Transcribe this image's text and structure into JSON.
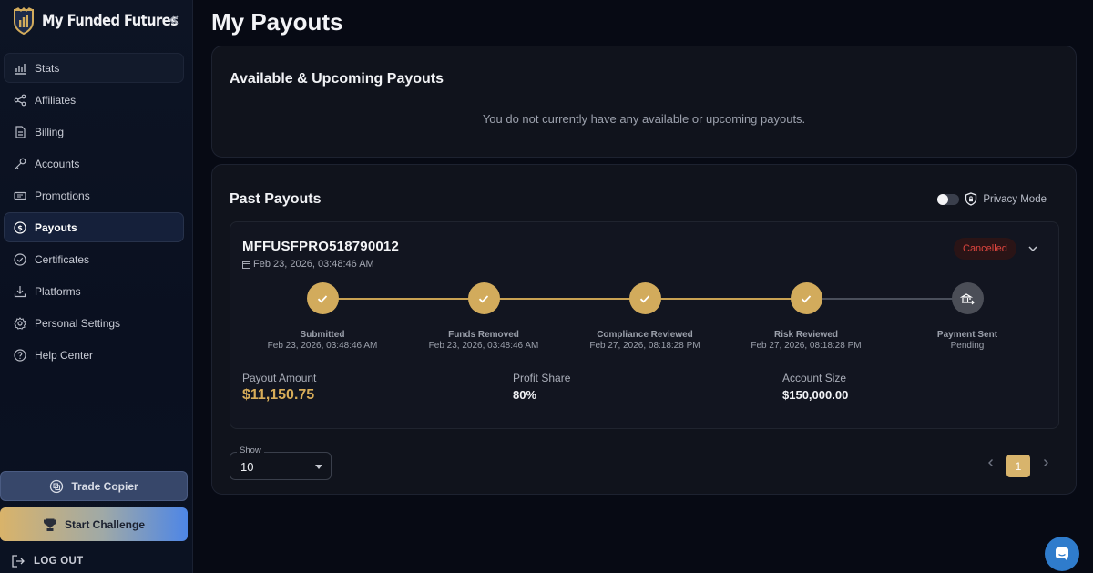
{
  "brand": {
    "name": "My Funded Futures"
  },
  "sidebar": {
    "items": [
      {
        "label": "Stats",
        "icon": "bar-chart-icon"
      },
      {
        "label": "Affiliates",
        "icon": "share-icon"
      },
      {
        "label": "Billing",
        "icon": "document-icon"
      },
      {
        "label": "Accounts",
        "icon": "key-icon"
      },
      {
        "label": "Promotions",
        "icon": "ticket-icon"
      },
      {
        "label": "Payouts",
        "icon": "dollar-circle-icon",
        "active": true
      },
      {
        "label": "Certificates",
        "icon": "check-circle-icon"
      },
      {
        "label": "Platforms",
        "icon": "download-icon"
      },
      {
        "label": "Personal Settings",
        "icon": "gear-icon"
      },
      {
        "label": "Help Center",
        "icon": "help-circle-icon"
      }
    ],
    "trade_copier": "Trade Copier",
    "start_challenge": "Start Challenge",
    "logout": "LOG OUT"
  },
  "page": {
    "title": "My Payouts"
  },
  "upcoming": {
    "title": "Available & Upcoming Payouts",
    "empty": "You do not currently have any available or upcoming payouts."
  },
  "past": {
    "title": "Past Payouts",
    "privacy_mode": "Privacy Mode",
    "privacy_enabled": false,
    "payouts": [
      {
        "id": "MFFUSFPRO518790012",
        "date": "Feb 23, 2026, 03:48:46 AM",
        "status": "Cancelled",
        "steps": [
          {
            "label": "Submitted",
            "sub": "Feb 23, 2026, 03:48:46 AM",
            "done": true
          },
          {
            "label": "Funds Removed",
            "sub": "Feb 23, 2026, 03:48:46 AM",
            "done": true
          },
          {
            "label": "Compliance Reviewed",
            "sub": "Feb 27, 2026, 08:18:28 PM",
            "done": true
          },
          {
            "label": "Risk Reviewed",
            "sub": "Feb 27, 2026, 08:18:28 PM",
            "done": true
          },
          {
            "label": "Payment Sent",
            "sub": "Pending",
            "done": false
          }
        ],
        "payout_amount_label": "Payout Amount",
        "payout_amount": "$11,150.75",
        "profit_share_label": "Profit Share",
        "profit_share": "80%",
        "account_size_label": "Account Size",
        "account_size": "$150,000.00"
      }
    ],
    "show_label": "Show",
    "show_value": "10",
    "current_page": "1"
  },
  "colors": {
    "accent_gold": "#d2ab5c",
    "cancelled": "#e0463f",
    "chat_blue": "#2f7ccc"
  }
}
